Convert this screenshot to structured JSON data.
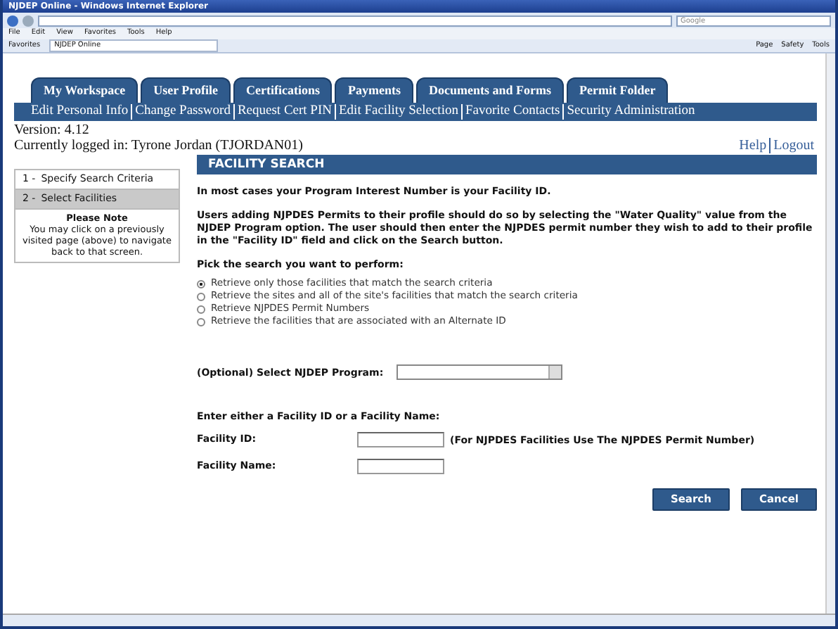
{
  "window": {
    "title": "NJDEP Online - Windows Internet Explorer"
  },
  "browser": {
    "menu": [
      "File",
      "Edit",
      "View",
      "Favorites",
      "Tools",
      "Help"
    ],
    "search_placeholder": "Google",
    "favorites_label": "Favorites",
    "page_tab": "NJDEP Online",
    "command_bar": [
      "Page",
      "Safety",
      "Tools"
    ]
  },
  "tabs": [
    {
      "label": "My Workspace"
    },
    {
      "label": "User Profile"
    },
    {
      "label": "Certifications"
    },
    {
      "label": "Payments"
    },
    {
      "label": "Documents and Forms"
    },
    {
      "label": "Permit Folder"
    }
  ],
  "subnav": [
    "Edit Personal Info",
    "Change Password",
    "Request Cert PIN",
    "Edit Facility Selection",
    "Favorite Contacts",
    "Security Administration"
  ],
  "version": "Version: 4.12",
  "logged_in": "Currently logged in: Tyrone Jordan (TJORDAN01)",
  "top_links": [
    "Help",
    "Logout"
  ],
  "steps": [
    {
      "number": "1 -",
      "label": "Specify Search Criteria",
      "selected": false
    },
    {
      "number": "2 -",
      "label": "Select Facilities",
      "selected": true
    }
  ],
  "note": {
    "title": "Please Note",
    "text": "You may click on a previously visited page (above) to navigate back to that screen."
  },
  "form": {
    "title": "FACILITY SEARCH",
    "paragraphs": [
      "In most cases your Program Interest Number is your Facility ID.",
      "Users adding NJPDES Permits to their profile should do so by selecting the \"Water Quality\" value from the NJDEP Program option. The user should then enter the NJPDES permit number they wish to add to their profile in the \"Facility ID\" field and click on the Search button."
    ],
    "search_prompt": "Pick the search you want to perform:",
    "options": [
      {
        "label": "Retrieve only those facilities that match the search criteria",
        "selected": true
      },
      {
        "label": "Retrieve the sites and all of the site's facilities that match the search criteria",
        "selected": false
      },
      {
        "label": "Retrieve NJPDES Permit Numbers",
        "selected": false
      },
      {
        "label": "Retrieve the facilities that are associated with an Alternate ID",
        "selected": false
      }
    ],
    "program_label": "(Optional) Select NJDEP Program:",
    "either_label": "Enter either a Facility ID or a Facility Name:",
    "facility_id_label": "Facility ID:",
    "facility_id_note": "(For NJPDES Facilities Use The NJPDES Permit Number)",
    "facility_name_label": "Facility Name:",
    "buttons": [
      "Search",
      "Cancel"
    ]
  }
}
